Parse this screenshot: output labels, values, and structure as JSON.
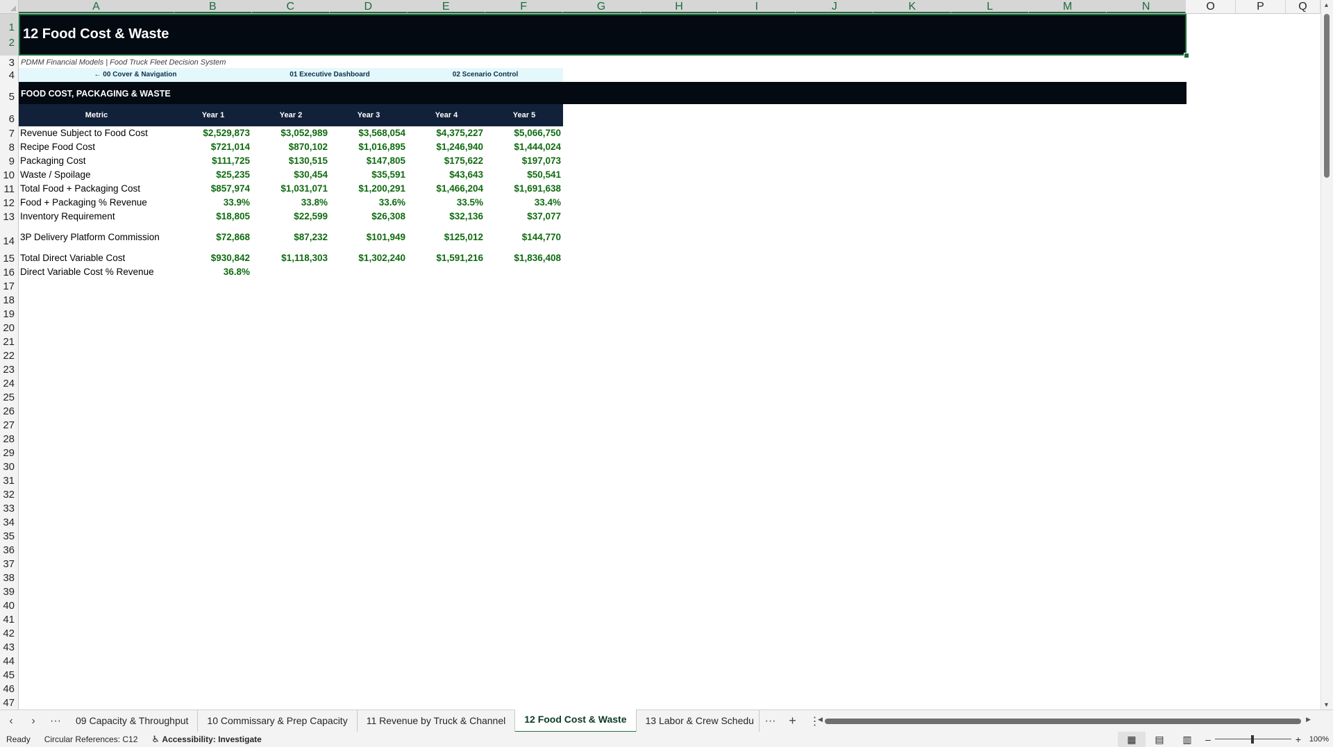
{
  "columns": [
    "A",
    "B",
    "C",
    "D",
    "E",
    "F",
    "G",
    "H",
    "I",
    "J",
    "K",
    "L",
    "M",
    "N",
    "O",
    "P",
    "Q"
  ],
  "rows": [
    "1",
    "2",
    "3",
    "4",
    "5",
    "6",
    "7",
    "8",
    "9",
    "10",
    "11",
    "12",
    "13",
    "14",
    "15",
    "16",
    "17",
    "18",
    "19",
    "20",
    "21",
    "22",
    "23",
    "24",
    "25",
    "26",
    "27",
    "28",
    "29",
    "30",
    "31",
    "32",
    "33",
    "34",
    "35",
    "36",
    "37",
    "38",
    "39",
    "40",
    "41",
    "42",
    "43",
    "44",
    "45",
    "46",
    "47"
  ],
  "sheet": {
    "title": "12 Food Cost & Waste",
    "subtitle": "PDMM Financial Models | Food Truck Fleet Decision System",
    "nav": [
      "← 00 Cover & Navigation",
      "01 Executive Dashboard",
      "02 Scenario Control"
    ],
    "section": "FOOD COST, PACKAGING & WASTE",
    "headers": [
      "Metric",
      "Year 1",
      "Year 2",
      "Year 3",
      "Year 4",
      "Year 5"
    ],
    "table": [
      {
        "metric": "Revenue Subject to Food Cost",
        "values": [
          "$2,529,873",
          "$3,052,989",
          "$3,568,054",
          "$4,375,227",
          "$5,066,750"
        ]
      },
      {
        "metric": "Recipe Food Cost",
        "values": [
          "$721,014",
          "$870,102",
          "$1,016,895",
          "$1,246,940",
          "$1,444,024"
        ]
      },
      {
        "metric": "Packaging Cost",
        "values": [
          "$111,725",
          "$130,515",
          "$147,805",
          "$175,622",
          "$197,073"
        ]
      },
      {
        "metric": "Waste / Spoilage",
        "values": [
          "$25,235",
          "$30,454",
          "$35,591",
          "$43,643",
          "$50,541"
        ]
      },
      {
        "metric": "Total Food + Packaging Cost",
        "values": [
          "$857,974",
          "$1,031,071",
          "$1,200,291",
          "$1,466,204",
          "$1,691,638"
        ]
      },
      {
        "metric": "Food + Packaging % Revenue",
        "values": [
          "33.9%",
          "33.8%",
          "33.6%",
          "33.5%",
          "33.4%"
        ]
      },
      {
        "metric": "Inventory Requirement",
        "values": [
          "$18,805",
          "$22,599",
          "$26,308",
          "$32,136",
          "$37,077"
        ]
      },
      {
        "metric": "3P Delivery Platform Commission",
        "values": [
          "$72,868",
          "$87,232",
          "$101,949",
          "$125,012",
          "$144,770"
        ]
      },
      {
        "metric": "Total Direct Variable Cost",
        "values": [
          "$930,842",
          "$1,118,303",
          "$1,302,240",
          "$1,591,216",
          "$1,836,408"
        ]
      },
      {
        "metric": "Direct Variable Cost % Revenue",
        "values": [
          "36.8%",
          "",
          "",
          "",
          ""
        ]
      }
    ]
  },
  "tabs": {
    "ellipsis": "···",
    "items": [
      "09 Capacity & Throughput",
      "10 Commissary & Prep Capacity",
      "11 Revenue by Truck & Channel",
      "12 Food Cost & Waste",
      "13 Labor & Crew Schedu"
    ],
    "active": "12 Food Cost & Waste",
    "more": "···",
    "add": "+"
  },
  "status": {
    "ready": "Ready",
    "circular": "Circular References: C12",
    "accessibility": "Accessibility: Investigate",
    "zoom": "100%"
  },
  "colors": {
    "title_bg": "#040a12",
    "header_bg": "#12213a",
    "value_green": "#0f6b10",
    "nav_bg": "#e4f8fb",
    "select_green": "#1e6b3a"
  }
}
